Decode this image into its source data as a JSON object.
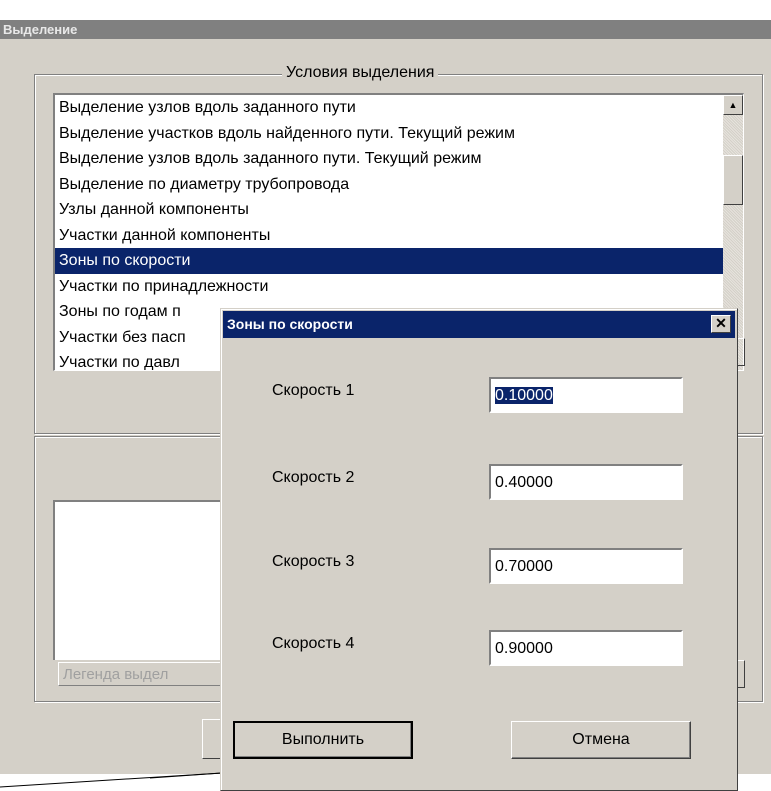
{
  "main_window": {
    "title": "Выделение",
    "conditions_group_title": "Условия  выделения",
    "conditions": [
      {
        "label": "Выделение узлов вдоль заданного пути",
        "selected": false
      },
      {
        "label": "Выделение участков вдоль найденного пути. Текущий режим",
        "selected": false
      },
      {
        "label": "Выделение узлов вдоль заданного пути. Текущий режим",
        "selected": false
      },
      {
        "label": "Выделение по диаметру трубопровода",
        "selected": false
      },
      {
        "label": "Узлы данной компоненты",
        "selected": false
      },
      {
        "label": "Участки данной компоненты",
        "selected": false
      },
      {
        "label": "Зоны по скорости",
        "selected": true
      },
      {
        "label": "Участки по принадлежности",
        "selected": false
      },
      {
        "label": "Зоны по годам п",
        "selected": false
      },
      {
        "label": "Участки без пасп",
        "selected": false
      },
      {
        "label": "Участки по давл",
        "selected": false
      }
    ],
    "legend_label": "Легенда выдел"
  },
  "dialog": {
    "title": "Зоны по скорости",
    "close_glyph": "✕",
    "fields": [
      {
        "label": "Скорость 1",
        "value": "0.10000",
        "focused": true
      },
      {
        "label": "Скорость 2",
        "value": "0.40000",
        "focused": false
      },
      {
        "label": "Скорость 3",
        "value": "0.70000",
        "focused": false
      },
      {
        "label": "Скорость 4",
        "value": "0.90000",
        "focused": false
      }
    ],
    "execute_label": "Выполнить",
    "cancel_label": "Отмена"
  },
  "colors": {
    "window_bg": "#d4d0c8",
    "selection": "#0a246a",
    "inactive_title": "#808080"
  },
  "icons": {
    "scroll_up": "scroll-up-arrow-icon",
    "close": "close-icon"
  }
}
